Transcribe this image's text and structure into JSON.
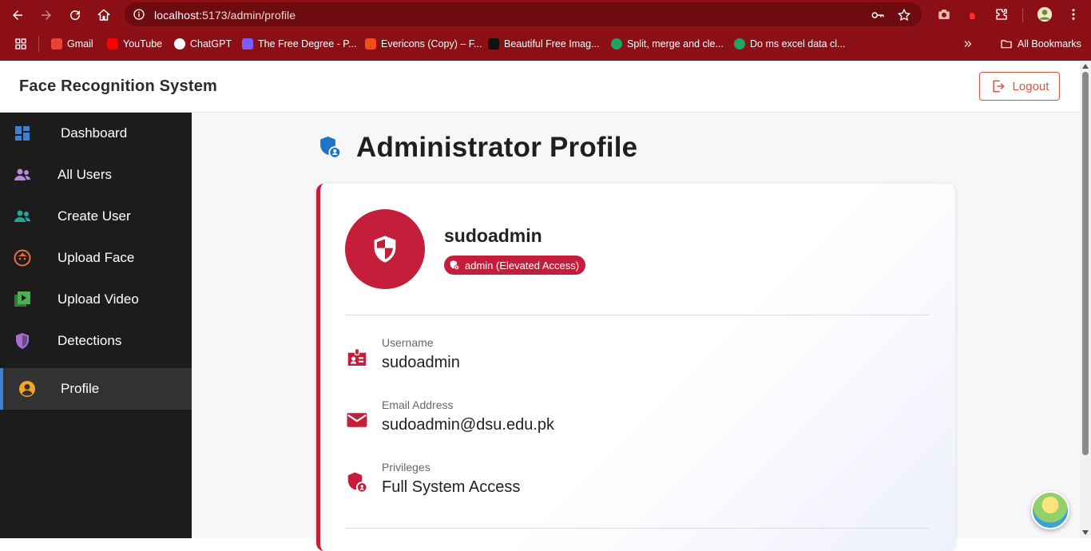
{
  "browser": {
    "url_host": "localhost",
    "url_rest": ":5173/admin/profile",
    "bookmarks": [
      {
        "label": "Gmail",
        "color": "#ea4335"
      },
      {
        "label": "YouTube",
        "color": "#ff0000"
      },
      {
        "label": "ChatGPT",
        "color": "#ffffff"
      },
      {
        "label": "The Free Degree - P...",
        "color": "#7b5cff"
      },
      {
        "label": "Evericons (Copy) – F...",
        "color": "#f24e1e"
      },
      {
        "label": "Beautiful Free Imag...",
        "color": "#111111"
      },
      {
        "label": "Split, merge and cle...",
        "color": "#1fa463"
      },
      {
        "label": "Do ms excel data cl...",
        "color": "#1fa463"
      }
    ],
    "all_bookmarks": "All Bookmarks"
  },
  "header": {
    "title": "Face Recognition System",
    "logout_label": "Logout"
  },
  "sidebar": {
    "items": [
      {
        "label": "Dashboard",
        "icon": "dashboard-icon",
        "color": "#3b82d6"
      },
      {
        "label": "All Users",
        "icon": "users-icon",
        "color": "#b48bd8"
      },
      {
        "label": "Create User",
        "icon": "create-user-icon",
        "color": "#26a69a"
      },
      {
        "label": "Upload Face",
        "icon": "face-icon",
        "color": "#f06b3c"
      },
      {
        "label": "Upload Video",
        "icon": "video-icon",
        "color": "#4caf50"
      },
      {
        "label": "Detections",
        "icon": "shield-icon",
        "color": "#a66cd8"
      },
      {
        "label": "Profile",
        "icon": "account-circle-icon",
        "color": "#f5a623"
      }
    ],
    "active_index": 6
  },
  "main": {
    "page_title": "Administrator Profile",
    "profile": {
      "name": "sudoadmin",
      "role_badge": "admin (Elevated Access)",
      "fields": [
        {
          "label": "Username",
          "value": "sudoadmin",
          "icon": "badge-icon"
        },
        {
          "label": "Email Address",
          "value": "sudoadmin@dsu.edu.pk",
          "icon": "mail-icon"
        },
        {
          "label": "Privileges",
          "value": "Full System Access",
          "icon": "admin-shield-icon"
        }
      ]
    },
    "accent_color": "#c41e3a"
  }
}
